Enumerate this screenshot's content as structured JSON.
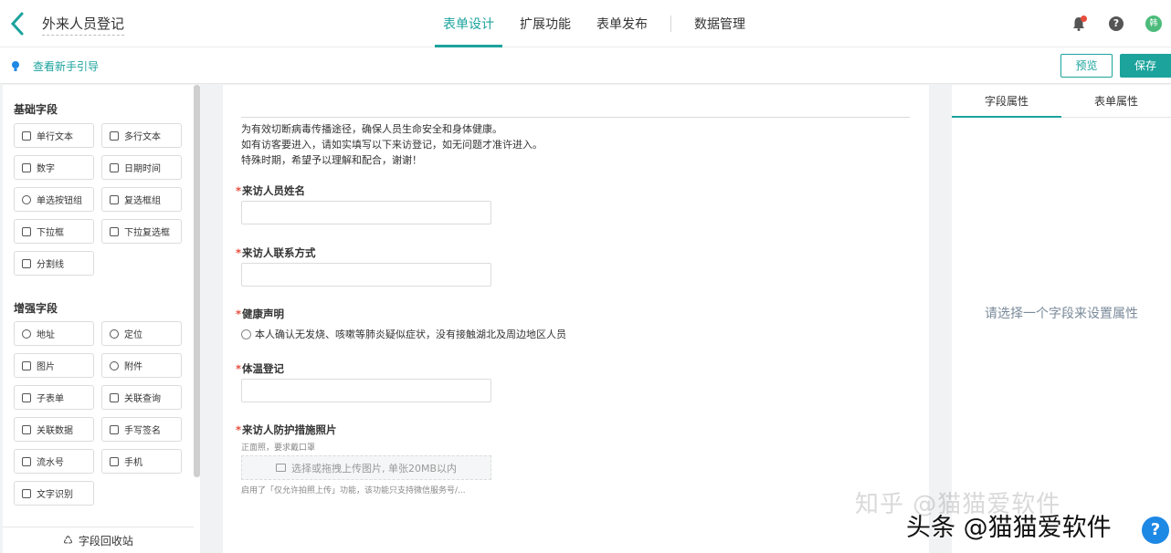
{
  "header": {
    "form_title": "外来人员登记",
    "tabs": [
      {
        "label": "表单设计",
        "active": true
      },
      {
        "label": "扩展功能",
        "active": false
      },
      {
        "label": "表单发布",
        "active": false
      },
      {
        "label": "数据管理",
        "active": false
      }
    ],
    "avatar_text": "韩",
    "help_glyph": "?"
  },
  "subbar": {
    "guide_label": "查看新手引导",
    "preview_label": "预览",
    "save_label": "保存"
  },
  "left": {
    "basic_title": "基础字段",
    "basic_fields": [
      "单行文本",
      "多行文本",
      "数字",
      "日期时间",
      "单选按钮组",
      "复选框组",
      "下拉框",
      "下拉复选框",
      "分割线"
    ],
    "advanced_title": "增强字段",
    "advanced_fields": [
      "地址",
      "定位",
      "图片",
      "附件",
      "子表单",
      "关联查询",
      "关联数据",
      "手写签名",
      "流水号",
      "手机",
      "文字识别"
    ],
    "recycle_label": "字段回收站"
  },
  "canvas": {
    "intro_lines": [
      "为有效切断病毒传播途径，确保人员生命安全和身体健康。",
      "如有访客要进入，请如实填写以下来访登记，如无问题才准许进入。",
      "特殊时期，希望予以理解和配合，谢谢！"
    ],
    "fields": {
      "name": {
        "required_mark": "*",
        "label": "来访人员姓名"
      },
      "contact": {
        "required_mark": "*",
        "label": "来访人联系方式"
      },
      "health": {
        "required_mark": "*",
        "label": "健康声明",
        "option": "本人确认无发烧、咳嗽等肺炎疑似症状，没有接触湖北及周边地区人员"
      },
      "temperature": {
        "required_mark": "*",
        "label": "体温登记"
      },
      "photo": {
        "required_mark": "*",
        "label": "来访人防护措施照片",
        "hint": "正面照，要求戴口罩",
        "upload_text": "选择或拖拽上传图片, 单张20MB以内",
        "note": "启用了「仅允许拍照上传」功能，该功能只支持微信服务号/..."
      }
    }
  },
  "right": {
    "tabs": [
      {
        "label": "字段属性",
        "active": true
      },
      {
        "label": "表单属性",
        "active": false
      }
    ],
    "placeholder": "请选择一个字段来设置属性"
  },
  "watermarks": {
    "zhihu": "知乎 @猫猫爱软件",
    "toutiao": "头条 @猫猫爱软件"
  },
  "colors": {
    "accent": "#1ba39c",
    "required": "#e74c3c"
  }
}
